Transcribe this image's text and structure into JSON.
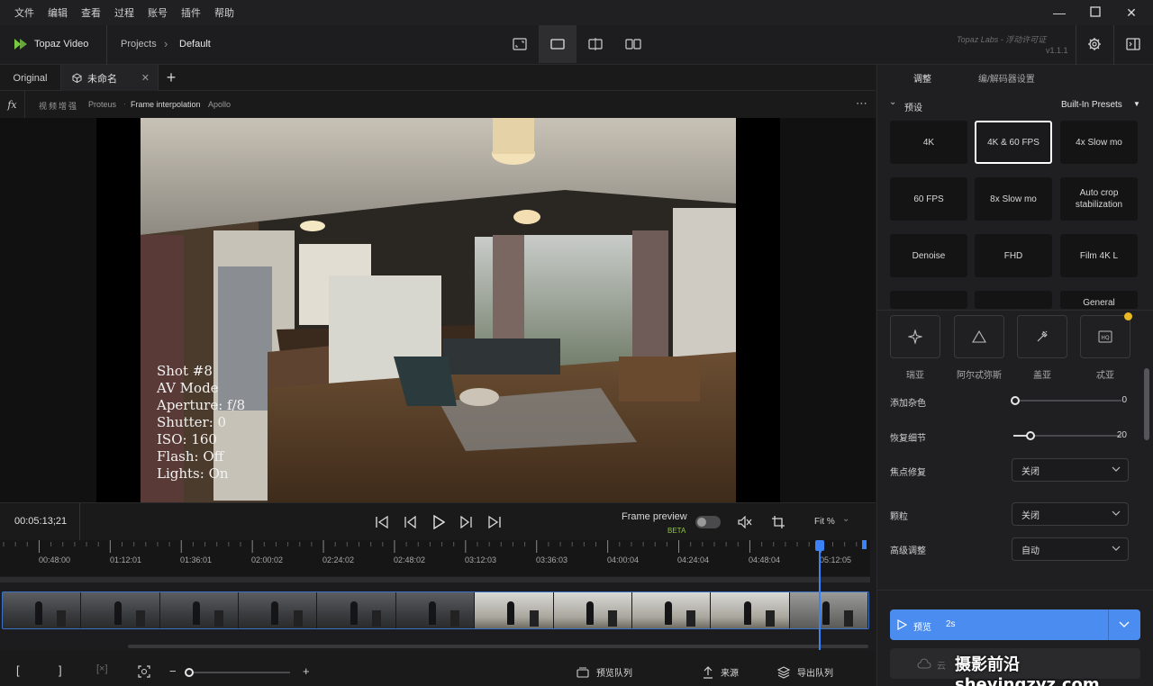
{
  "menu": [
    "文件",
    "编辑",
    "查看",
    "过程",
    "账号",
    "插件",
    "帮助"
  ],
  "topbar": {
    "app_name": "Topaz Video",
    "crumb_projects": "Projects",
    "crumb_current": "Default",
    "license": "Topaz Labs - 浮动许可证",
    "version": "v1.1.1"
  },
  "tabs": {
    "original": "Original",
    "current": "未命名"
  },
  "filters": {
    "enhance": "视频增强",
    "enhance_model": "Proteus",
    "interp": "Frame interpolation",
    "interp_model": "Apollo"
  },
  "overlay": [
    "Shot #8",
    "AV Mode",
    "Aperture: f/8",
    "Shutter: 0",
    "ISO: 160",
    "Flash: Off",
    "Lights: On"
  ],
  "transport": {
    "timecode": "00:05:13;21",
    "frame_preview": "Frame preview",
    "beta": "BETA",
    "fit": "Fit %"
  },
  "ruler": [
    "00:48:00",
    "01:12:01",
    "01:36:01",
    "02:00:02",
    "02:24:02",
    "02:48:02",
    "03:12:03",
    "03:36:03",
    "04:00:04",
    "04:24:04",
    "04:48:04",
    "05:12:05"
  ],
  "bottombar": {
    "preview_queue": "预览队列",
    "source": "来源",
    "export_queue": "导出队列"
  },
  "right": {
    "tab_adjust": "调整",
    "tab_codec": "编/解码器设置",
    "presets_label": "预设",
    "presets_dropdown": "Built-In Presets",
    "presets": [
      "4K",
      "4K & 60 FPS",
      "4x Slow mo",
      "60 FPS",
      "8x Slow mo",
      "Auto crop stabilization",
      "Denoise",
      "FHD",
      "Film 4K L",
      "",
      "",
      "General"
    ],
    "models": [
      "瑞亚",
      "阿尔忒弥斯",
      "盖亚",
      "忒亚"
    ],
    "add_noise": {
      "label": "添加杂色",
      "value": "0"
    },
    "recover_detail": {
      "label": "恢复细节",
      "value": "20"
    },
    "focus_fix": {
      "label": "焦点修复",
      "value": "关闭"
    },
    "grain": {
      "label": "颗粒",
      "value": "关闭"
    },
    "advanced": {
      "label": "高级调整",
      "value": "自动"
    },
    "preview_btn": "预览",
    "preview_dur": "2s",
    "cloud_btn": "云",
    "watermark": "摄影前沿 sheyingzyz.com"
  },
  "colors": {
    "accent": "#4a8cf0",
    "playhead": "#3b82f6",
    "beta": "#8fc63f",
    "logo": "#7ac943"
  }
}
